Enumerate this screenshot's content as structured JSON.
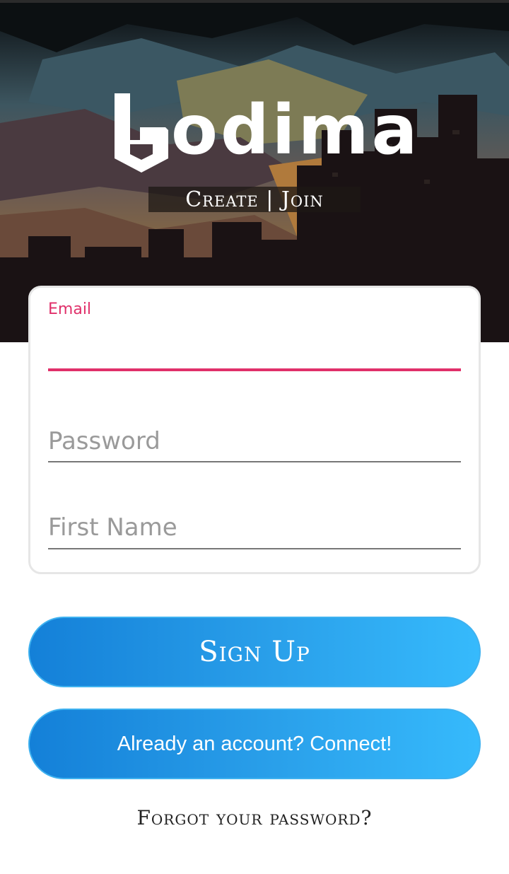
{
  "brand": {
    "name": "odima",
    "tagline": "Create | Join"
  },
  "form": {
    "email": {
      "label": "Email",
      "value": ""
    },
    "password": {
      "placeholder": "Password",
      "value": ""
    },
    "first_name": {
      "placeholder": "First Name",
      "value": ""
    }
  },
  "actions": {
    "signup_label": "Sign Up",
    "connect_label": "Already an account? Connect!",
    "forgot_label": "Forgot your password?"
  },
  "colors": {
    "accent": "#e0306a",
    "button_start": "#1480d8",
    "button_end": "#36bafc"
  }
}
